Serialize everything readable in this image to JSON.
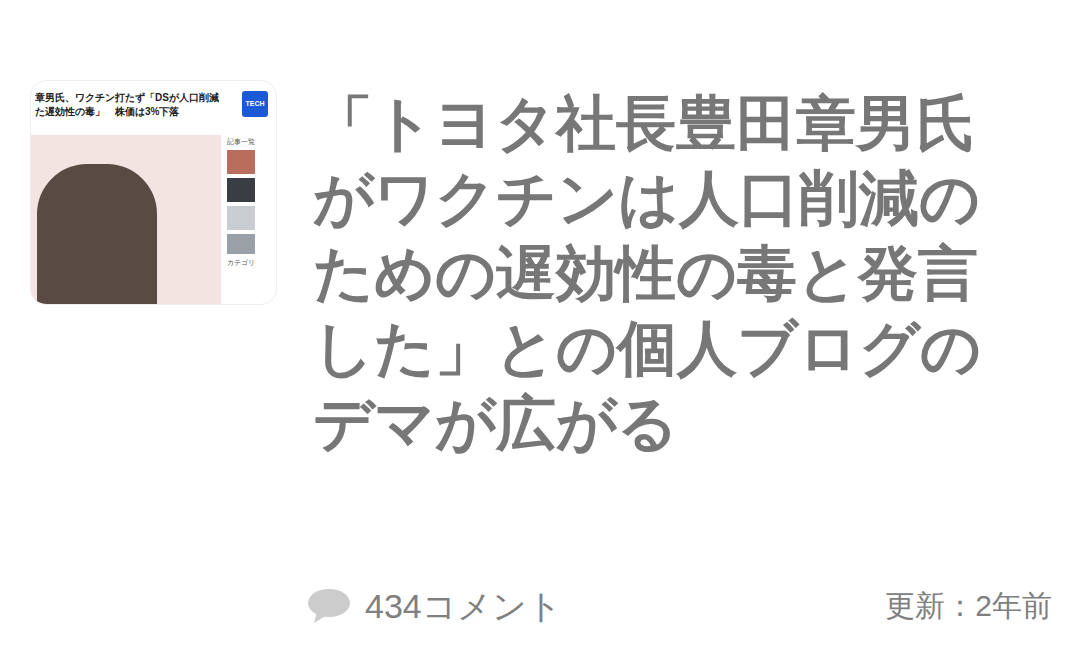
{
  "thumbnail": {
    "headline": [
      "章男氏、ワクチン打たず「DSが人口削減",
      "た遅効性の毒」　株価は3%下落"
    ],
    "badge": "TECH",
    "sidebar_heading": "記事一覧",
    "sidebar_footer": "カテゴリ"
  },
  "title": "「トヨタ社長豊田章男氏がワクチンは人口削減のための遅効性の毒と発言した」との個人ブログのデマが広がる",
  "comments": "434コメント",
  "updated": "更新：2年前"
}
